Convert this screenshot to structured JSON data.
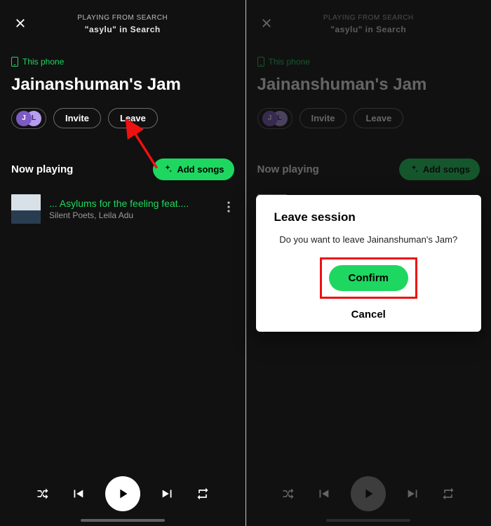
{
  "colors": {
    "accent": "#1ed760",
    "annotation": "#e11"
  },
  "header": {
    "source_label": "PLAYING FROM SEARCH",
    "context": "\"asylu\" in Search"
  },
  "device": {
    "label": "This phone"
  },
  "session": {
    "title": "Jainanshuman's Jam",
    "avatars": [
      {
        "initial": "J"
      },
      {
        "initial": "L"
      }
    ],
    "invite_label": "Invite",
    "leave_label": "Leave"
  },
  "now_playing": {
    "heading": "Now playing",
    "add_label": "Add songs",
    "track": {
      "name": "... Asylums for the feeling feat....",
      "artists": "Silent Poets, Leila Adu"
    }
  },
  "modal": {
    "title": "Leave session",
    "body": "Do you want to leave Jainanshuman's Jam?",
    "confirm": "Confirm",
    "cancel": "Cancel"
  }
}
